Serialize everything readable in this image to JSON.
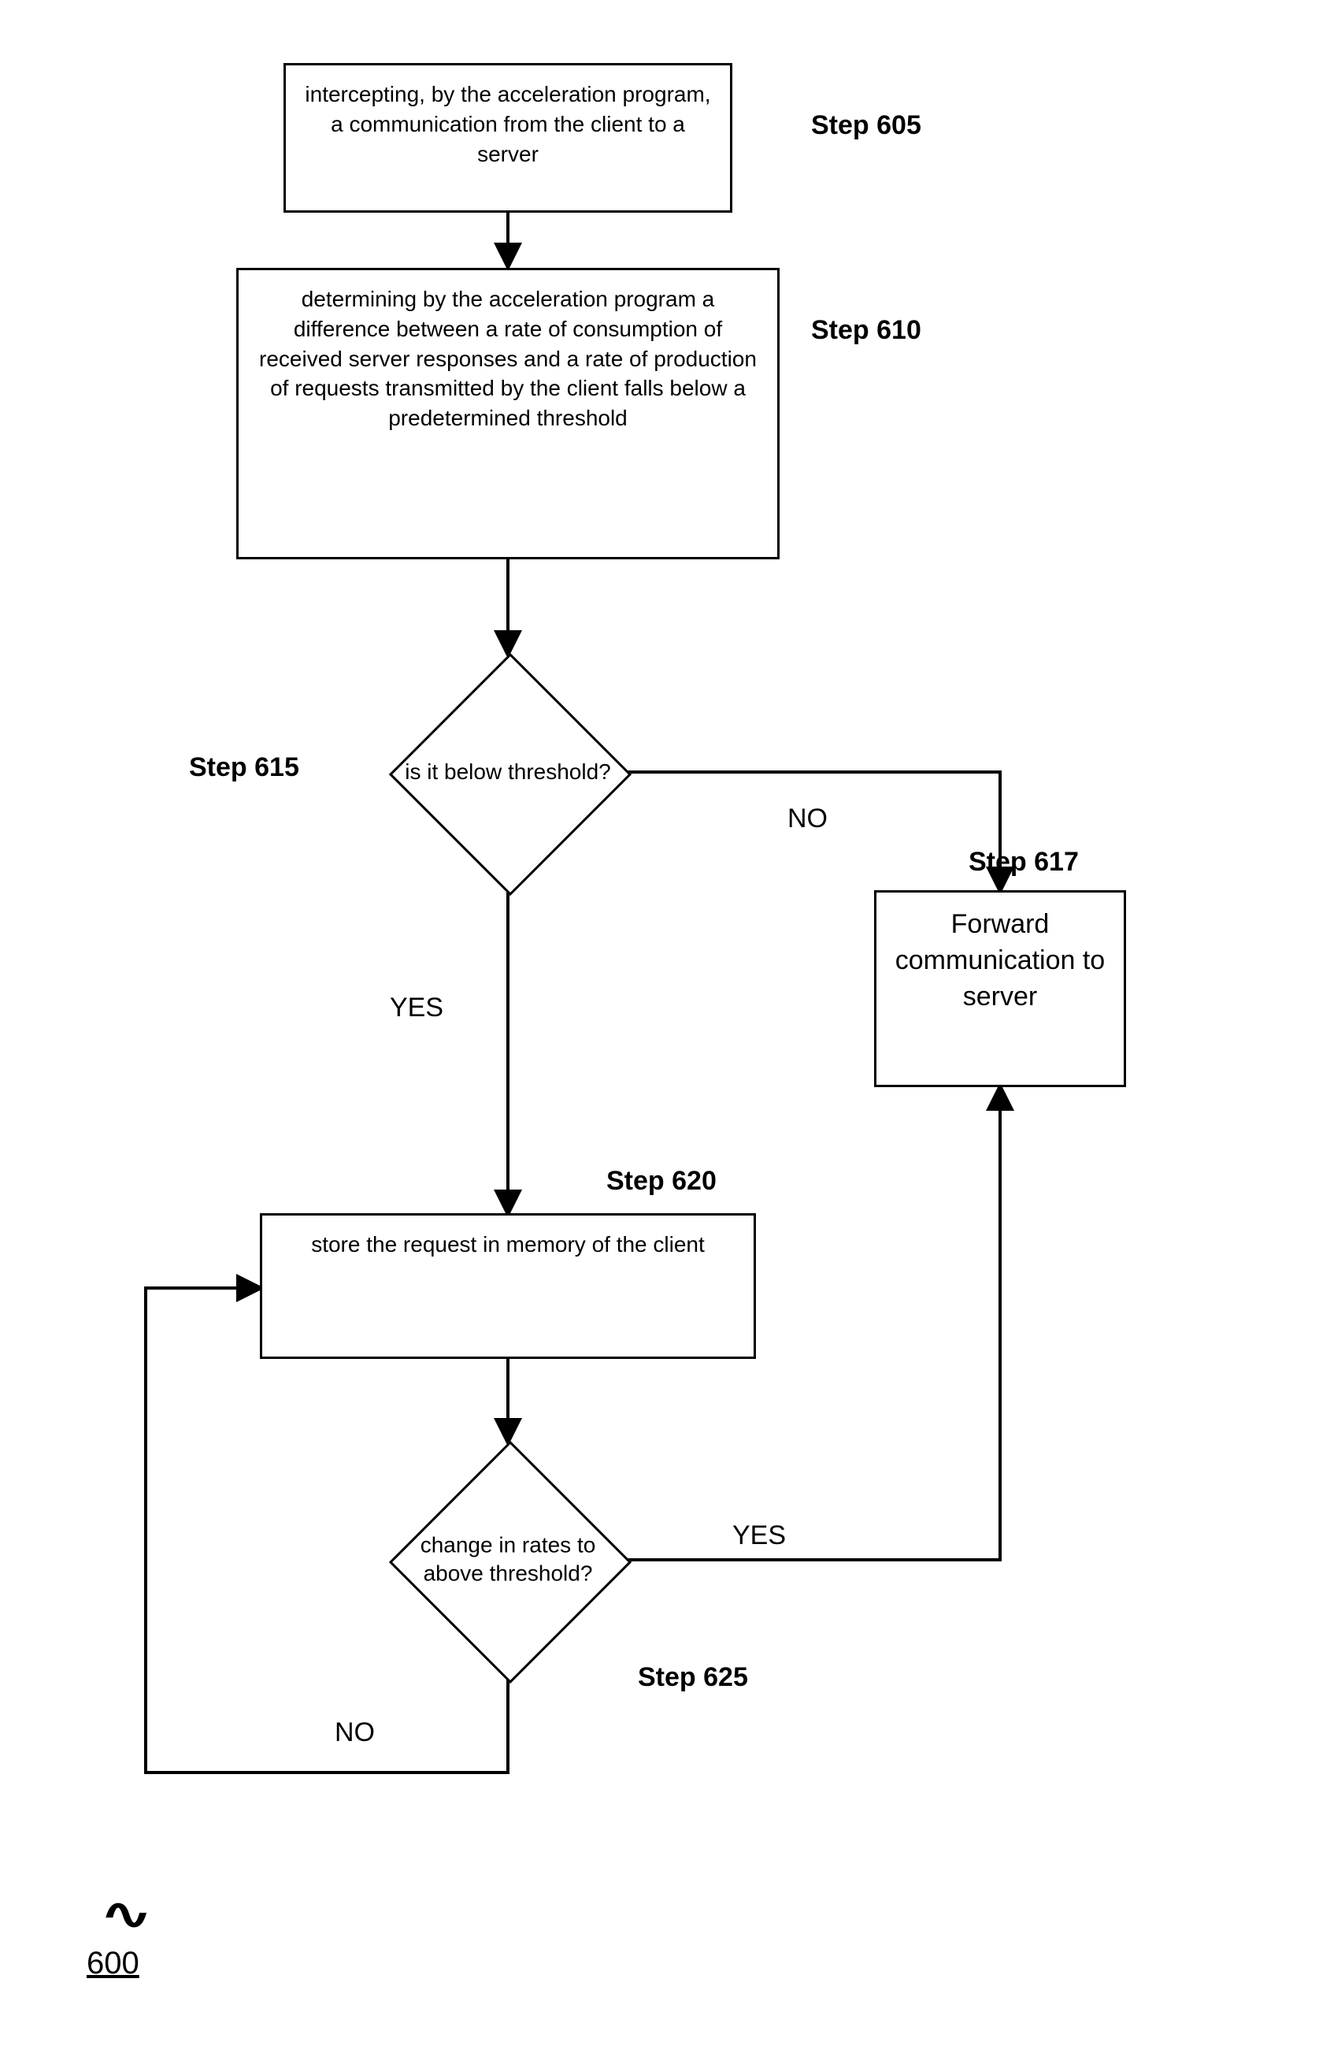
{
  "nodes": {
    "step605": "intercepting, by the acceleration program, a communication from  the client to a server",
    "step610": "determining by the acceleration program a difference between a rate of consumption of received server responses and a rate of production of requests transmitted by the client falls below a predetermined threshold",
    "step615": "is it below threshold?",
    "step617": "Forward communication to server",
    "step620": "store the request in memory of the client",
    "step625": "change in rates to above threshold?"
  },
  "step_labels": {
    "s605": "Step 605",
    "s610": "Step 610",
    "s615": "Step 615",
    "s617": "Step 617",
    "s620": "Step 620",
    "s625": "Step 625"
  },
  "edge_labels": {
    "no1": "NO",
    "yes1": "YES",
    "yes2": "YES",
    "no2": "NO"
  },
  "figure_ref": "600"
}
